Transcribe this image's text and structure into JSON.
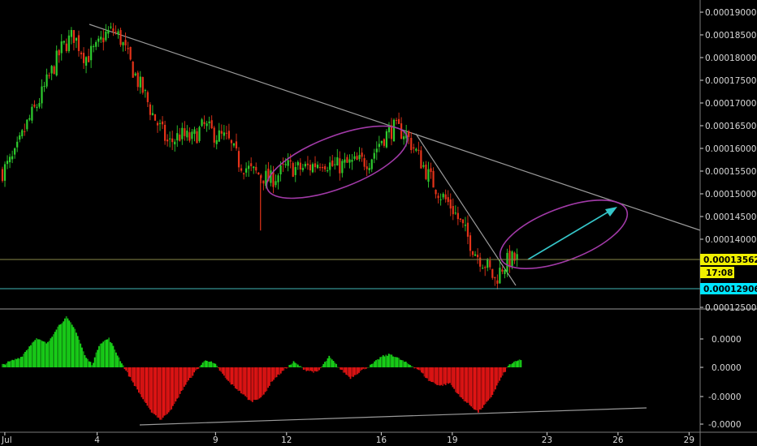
{
  "colors": {
    "background": "#000000",
    "axis_text": "#d8d8d8",
    "separator": "#7a7a7a",
    "up": "#2ecc2e",
    "down": "#e53319",
    "osc_up": "#19d219",
    "osc_down": "#e11414",
    "trendline": "#9a9a9a",
    "ellipse": "#a23aa8",
    "arrow": "#35c6c9",
    "price_line": "#8a8a4a",
    "price_badge": "#f0f000",
    "support_line": "#3fb6b6",
    "support_badge": "#00e5ff"
  },
  "chart_data": [
    {
      "type": "candlestick",
      "y_tick_labels": [
        "0.00019000",
        "0.00018500",
        "0.00018000",
        "0.00017500",
        "0.00017000",
        "0.00016500",
        "0.00016000",
        "0.00015500",
        "0.00015000",
        "0.00014500",
        "0.00014000",
        "0.00013562",
        "17:08",
        "0.00012906",
        "0.00012500"
      ],
      "ylim": [
        0.000125,
        0.00019
      ],
      "x_tick_labels": [
        "Jul",
        "4",
        "9",
        "12",
        "16",
        "19",
        "23",
        "26",
        "29"
      ],
      "x_tick_days": [
        0.1,
        4,
        9,
        12,
        16,
        19,
        23,
        26,
        29
      ],
      "series_path": [
        [
          0.0,
          0.000155
        ],
        [
          0.5,
          0.000158
        ],
        [
          1.0,
          0.000165
        ],
        [
          1.5,
          0.00017
        ],
        [
          2.0,
          0.000176
        ],
        [
          2.5,
          0.000182
        ],
        [
          3.0,
          0.000185
        ],
        [
          3.5,
          0.00018
        ],
        [
          4.0,
          0.000182
        ],
        [
          4.3,
          0.000185
        ],
        [
          4.7,
          0.000186
        ],
        [
          5.0,
          0.000184
        ],
        [
          5.3,
          0.00018
        ],
        [
          5.7,
          0.000175
        ],
        [
          6.0,
          0.000172
        ],
        [
          6.3,
          0.000168
        ],
        [
          6.7,
          0.000164
        ],
        [
          7.0,
          0.000161
        ],
        [
          7.5,
          0.000163
        ],
        [
          8.0,
          0.000162
        ],
        [
          8.5,
          0.000165
        ],
        [
          9.0,
          0.000163
        ],
        [
          9.5,
          0.000162
        ],
        [
          10.0,
          0.000157
        ],
        [
          10.5,
          0.000155
        ],
        [
          11.0,
          0.000154
        ],
        [
          11.3,
          0.000153
        ],
        [
          11.7,
          0.0001545
        ],
        [
          12.0,
          0.000156
        ],
        [
          12.5,
          0.0001555
        ],
        [
          13.0,
          0.000156
        ],
        [
          13.5,
          0.0001575
        ],
        [
          14.0,
          0.000156
        ],
        [
          14.5,
          0.0001565
        ],
        [
          15.0,
          0.000157
        ],
        [
          15.5,
          0.0001575
        ],
        [
          16.0,
          0.000162
        ],
        [
          16.5,
          0.0001645
        ],
        [
          17.0,
          0.0001635
        ],
        [
          17.5,
          0.000159
        ],
        [
          18.0,
          0.000154
        ],
        [
          18.5,
          0.00015
        ],
        [
          19.0,
          0.000147
        ],
        [
          19.5,
          0.000142
        ],
        [
          20.0,
          0.000137
        ],
        [
          20.5,
          0.000134
        ],
        [
          20.8,
          0.000131
        ],
        [
          21.1,
          0.000134
        ],
        [
          21.4,
          0.0001355
        ],
        [
          21.7,
          0.0001356
        ]
      ],
      "spike": {
        "day": 10.9,
        "low": 0.000142
      }
    },
    {
      "type": "histogram",
      "y_tick_labels": [
        "0.0000",
        "0.0000",
        "-0.0000",
        "-0.0000"
      ],
      "ylim": [
        -1.1,
        1.1
      ],
      "x_range_days": [
        0,
        21.9
      ],
      "envelope": [
        [
          0.0,
          0.05
        ],
        [
          0.8,
          0.2
        ],
        [
          1.4,
          0.55
        ],
        [
          1.9,
          0.45
        ],
        [
          2.3,
          0.75
        ],
        [
          2.7,
          0.95
        ],
        [
          3.1,
          0.7
        ],
        [
          3.5,
          0.2
        ],
        [
          3.8,
          0.05
        ],
        [
          4.1,
          0.45
        ],
        [
          4.5,
          0.55
        ],
        [
          4.9,
          0.2
        ],
        [
          5.2,
          -0.05
        ],
        [
          5.6,
          -0.35
        ],
        [
          6.2,
          -0.8
        ],
        [
          6.7,
          -1.0
        ],
        [
          7.2,
          -0.75
        ],
        [
          7.7,
          -0.35
        ],
        [
          8.2,
          -0.05
        ],
        [
          8.6,
          0.15
        ],
        [
          9.0,
          0.05
        ],
        [
          9.5,
          -0.25
        ],
        [
          10.0,
          -0.45
        ],
        [
          10.5,
          -0.65
        ],
        [
          11.0,
          -0.55
        ],
        [
          11.4,
          -0.25
        ],
        [
          11.9,
          -0.05
        ],
        [
          12.3,
          0.1
        ],
        [
          12.8,
          -0.05
        ],
        [
          13.3,
          -0.1
        ],
        [
          13.8,
          0.2
        ],
        [
          14.3,
          -0.05
        ],
        [
          14.7,
          -0.2
        ],
        [
          15.2,
          -0.05
        ],
        [
          15.6,
          0.05
        ],
        [
          16.0,
          0.2
        ],
        [
          16.4,
          0.25
        ],
        [
          16.8,
          0.15
        ],
        [
          17.2,
          0.05
        ],
        [
          17.6,
          -0.05
        ],
        [
          18.0,
          -0.25
        ],
        [
          18.5,
          -0.35
        ],
        [
          18.9,
          -0.3
        ],
        [
          19.3,
          -0.55
        ],
        [
          19.7,
          -0.7
        ],
        [
          20.1,
          -0.85
        ],
        [
          20.6,
          -0.6
        ],
        [
          21.0,
          -0.25
        ],
        [
          21.4,
          0.05
        ],
        [
          21.9,
          0.15
        ]
      ]
    }
  ]
}
